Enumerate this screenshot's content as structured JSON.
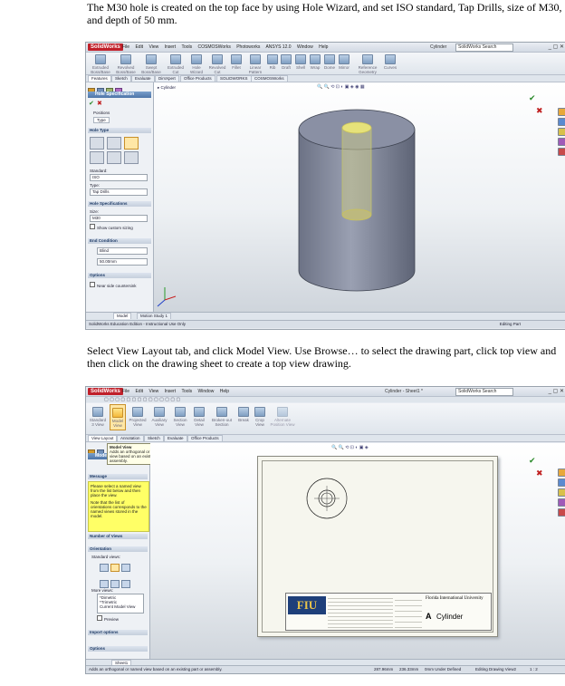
{
  "instructions": {
    "para1": "The M30 hole is created on the top face by using Hole Wizard, and set ISO standard, Tap Drills, size of M30, and depth of 50 mm.",
    "para2": "Select View Layout tab, and click Model View. Use Browse… to select the drawing part, click top view and then click on the drawing sheet to create a top view drawing."
  },
  "common": {
    "logo": "SolidWorks",
    "menu": [
      "File",
      "Edit",
      "View",
      "Insert",
      "Tools",
      "Window",
      "Help"
    ],
    "search_placeholder": "SolidWorks Search",
    "window_controls": "_ ▢ ✕"
  },
  "shot1": {
    "menu_extra": [
      "COSMOSWorks",
      "Photoworks",
      "ANSYS 12.0",
      "Window",
      "Help"
    ],
    "doc_title": "Cylinder",
    "tabs": [
      "Features",
      "Sketch",
      "Evaluate",
      "DimXpert",
      "Office Products",
      "SOLIDWORKS",
      "COSMOSWorks"
    ],
    "ribbon_items": [
      "Extruded Boss/Base",
      "Revolved Boss/Base",
      "Swept Boss/Base",
      "Lofted Boss/Base",
      "Extruded Cut",
      "Hole Wizard",
      "Revolved Cut",
      "Fillet",
      "Linear Pattern",
      "Rib",
      "Draft",
      "Shell",
      "Wrap",
      "Dome",
      "Mirror",
      "Reference Geometry",
      "Curves"
    ],
    "tree_root": "Cylinder",
    "panel_title": "Hole Specification",
    "subtabs": [
      "Positions",
      "Type"
    ],
    "hole_type_label": "Hole Type",
    "standard_label": "Standard:",
    "standard_value": "ISO",
    "type_label": "Type:",
    "type_value": "Tap Drills",
    "hole_specs_label": "Hole Specifications",
    "size_label": "Size:",
    "size_value": "M30",
    "custom_sizing": "Show custom sizing",
    "end_condition_label": "End Condition",
    "end_condition_value": "Blind",
    "depth_value": "50.00mm",
    "options_label": "Options",
    "near_side": "Near side countersink",
    "bottom_tabs": [
      "Model",
      "Motion Study 1"
    ],
    "status_left": "SolidWorks Education Edition - Instructional Use Only",
    "status_right": "Editing Part"
  },
  "shot2": {
    "doc_title": "Cylinder - Sheet1 *",
    "ribbon_items": [
      "Standard 3 View",
      "Model View",
      "Projected View",
      "Auxiliary View",
      "Section View",
      "Detail View",
      "Broken-out Section",
      "Break",
      "Crop View",
      "Alternate Position View"
    ],
    "tabs": [
      "View Layout",
      "Annotation",
      "Sketch",
      "Evaluate",
      "Office Products"
    ],
    "panel_title": "Model View",
    "tooltip_title": "Model View",
    "tooltip_text": "Adds an orthogonal or named view based on an existing part or assembly.",
    "message_label": "Message",
    "message_text": "Please select a named view from the list below and then place the view.",
    "message_note": "Note that the list of orientations corresponds to the named views stored in the model.",
    "number_of_views": "Number of Views",
    "orientation_label": "Orientation",
    "standard_views": "Standard views:",
    "more_views": "More views:",
    "more_views_items": [
      "*Dimetric",
      "*Trimetric",
      "Current Model View"
    ],
    "preview": "Preview",
    "import_options": "Import options",
    "options_label": "Options",
    "sheet_tab": "Sheet1",
    "titleblock_logo": "FIU",
    "university": "Florida International University",
    "part_name": "Cylinder",
    "size_letter": "A",
    "status_left": "Adds an orthogonal or named view based on an existing part or assembly.",
    "status_x": "287.96mm",
    "status_y": "236.33mm",
    "status_def": "0mm Under Defined",
    "status_edit": "Editing Drawing View2",
    "status_scale": "1 : 2"
  }
}
